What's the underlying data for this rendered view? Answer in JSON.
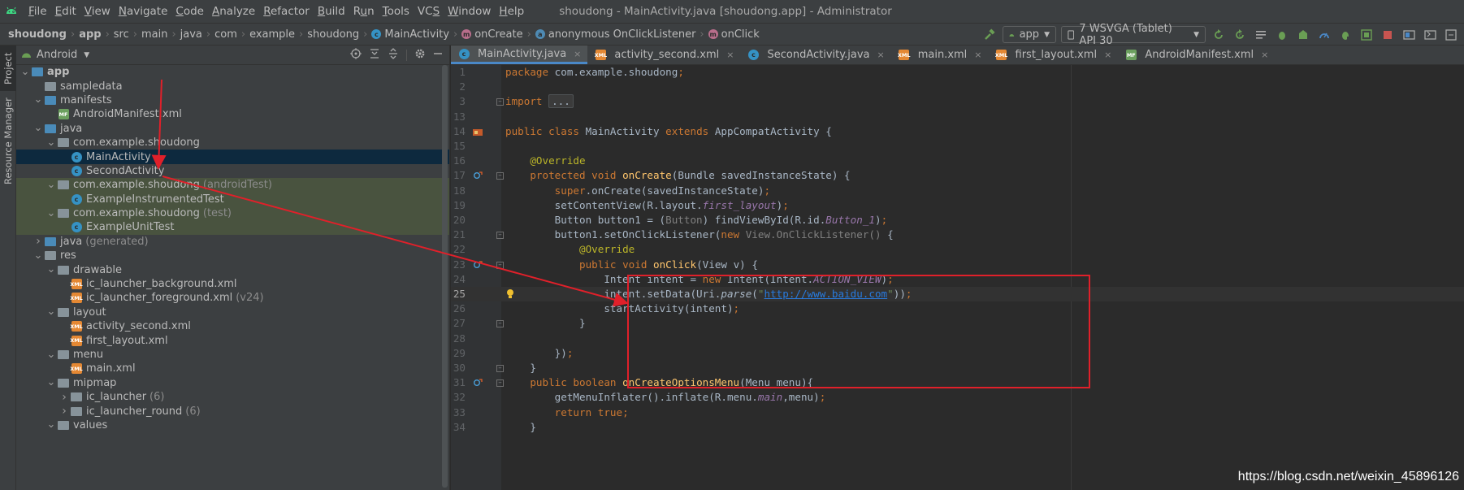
{
  "menubar": {
    "items": [
      {
        "label": "File",
        "mnemonic_index": 0
      },
      {
        "label": "Edit",
        "mnemonic_index": 0
      },
      {
        "label": "View",
        "mnemonic_index": 0
      },
      {
        "label": "Navigate",
        "mnemonic_index": 0
      },
      {
        "label": "Code",
        "mnemonic_index": 0
      },
      {
        "label": "Analyze",
        "mnemonic_index": 0
      },
      {
        "label": "Refactor",
        "mnemonic_index": 0
      },
      {
        "label": "Build",
        "mnemonic_index": 0
      },
      {
        "label": "Run",
        "mnemonic_index": 1
      },
      {
        "label": "Tools",
        "mnemonic_index": 0
      },
      {
        "label": "VCS",
        "mnemonic_index": 2
      },
      {
        "label": "Window",
        "mnemonic_index": 0
      },
      {
        "label": "Help",
        "mnemonic_index": 0
      }
    ],
    "window_title": "shoudong - MainActivity.java [shoudong.app] - Administrator"
  },
  "navbar": {
    "crumbs": [
      {
        "label": "shoudong",
        "bold": true
      },
      {
        "label": "app",
        "bold": true
      },
      {
        "label": "src"
      },
      {
        "label": "main"
      },
      {
        "label": "java"
      },
      {
        "label": "com"
      },
      {
        "label": "example"
      },
      {
        "label": "shoudong"
      },
      {
        "label": "MainActivity",
        "badge": "c"
      },
      {
        "label": "onCreate",
        "badge": "m"
      },
      {
        "label": "anonymous OnClickListener",
        "badge": "a"
      },
      {
        "label": "onClick",
        "badge": "m"
      }
    ],
    "run_config": "app",
    "device": "7  WSVGA (Tablet) API 30"
  },
  "stripe": {
    "project_tab": "Project",
    "resource_tab": "Resource Manager"
  },
  "project_panel": {
    "view_selector": "Android",
    "tree": [
      {
        "label": "app",
        "depth": 0,
        "expanded": true,
        "icon": "folder-blue",
        "bold": true
      },
      {
        "label": "sampledata",
        "depth": 1,
        "expanded": null,
        "icon": "folder"
      },
      {
        "label": "manifests",
        "depth": 1,
        "expanded": true,
        "icon": "folder-blue"
      },
      {
        "label": "AndroidManifest.xml",
        "depth": 2,
        "expanded": null,
        "icon": "manifest"
      },
      {
        "label": "java",
        "depth": 1,
        "expanded": true,
        "icon": "folder-blue"
      },
      {
        "label": "com.example.shoudong",
        "depth": 2,
        "expanded": true,
        "icon": "package"
      },
      {
        "label": "MainActivity",
        "depth": 3,
        "expanded": null,
        "icon": "class",
        "selected": true
      },
      {
        "label": "SecondActivity",
        "depth": 3,
        "expanded": null,
        "icon": "class"
      },
      {
        "label": "com.example.shoudong",
        "suffix": "(androidTest)",
        "depth": 2,
        "expanded": true,
        "icon": "package",
        "test": true
      },
      {
        "label": "ExampleInstrumentedTest",
        "depth": 3,
        "expanded": null,
        "icon": "class",
        "test": true
      },
      {
        "label": "com.example.shoudong",
        "suffix": "(test)",
        "depth": 2,
        "expanded": true,
        "icon": "package",
        "test": true
      },
      {
        "label": "ExampleUnitTest",
        "depth": 3,
        "expanded": null,
        "icon": "class",
        "test": true
      },
      {
        "label": "java",
        "suffix": "(generated)",
        "depth": 1,
        "expanded": false,
        "icon": "folder-blue"
      },
      {
        "label": "res",
        "depth": 1,
        "expanded": true,
        "icon": "folder"
      },
      {
        "label": "drawable",
        "depth": 2,
        "expanded": true,
        "icon": "folder"
      },
      {
        "label": "ic_launcher_background.xml",
        "depth": 3,
        "expanded": null,
        "icon": "xml"
      },
      {
        "label": "ic_launcher_foreground.xml",
        "suffix": "(v24)",
        "depth": 3,
        "expanded": null,
        "icon": "xml"
      },
      {
        "label": "layout",
        "depth": 2,
        "expanded": true,
        "icon": "folder"
      },
      {
        "label": "activity_second.xml",
        "depth": 3,
        "expanded": null,
        "icon": "xml"
      },
      {
        "label": "first_layout.xml",
        "depth": 3,
        "expanded": null,
        "icon": "xml"
      },
      {
        "label": "menu",
        "depth": 2,
        "expanded": true,
        "icon": "folder"
      },
      {
        "label": "main.xml",
        "depth": 3,
        "expanded": null,
        "icon": "xml"
      },
      {
        "label": "mipmap",
        "depth": 2,
        "expanded": true,
        "icon": "folder"
      },
      {
        "label": "ic_launcher",
        "suffix": "(6)",
        "depth": 3,
        "expanded": false,
        "icon": "folder"
      },
      {
        "label": "ic_launcher_round",
        "suffix": "(6)",
        "depth": 3,
        "expanded": false,
        "icon": "folder"
      },
      {
        "label": "values",
        "depth": 2,
        "expanded": true,
        "icon": "folder"
      }
    ]
  },
  "editor": {
    "tabs": [
      {
        "label": "MainActivity.java",
        "icon": "class",
        "active": true
      },
      {
        "label": "activity_second.xml",
        "icon": "xml"
      },
      {
        "label": "SecondActivity.java",
        "icon": "class"
      },
      {
        "label": "main.xml",
        "icon": "xml"
      },
      {
        "label": "first_layout.xml",
        "icon": "xml"
      },
      {
        "label": "AndroidManifest.xml",
        "icon": "manifest"
      }
    ],
    "lines": [
      {
        "n": "1",
        "tokens": [
          [
            "kw",
            "package "
          ],
          [
            "",
            "com.example.shoudong"
          ],
          [
            "kw",
            ";"
          ]
        ]
      },
      {
        "n": "2",
        "tokens": []
      },
      {
        "n": "3",
        "tokens": [
          [
            "kw",
            "import "
          ],
          [
            "dots",
            "..."
          ]
        ],
        "fold": true
      },
      {
        "n": "13",
        "tokens": []
      },
      {
        "n": "14",
        "tokens": [
          [
            "kw",
            "public class "
          ],
          [
            "",
            "MainActivity "
          ],
          [
            "kw",
            "extends "
          ],
          [
            "",
            "AppCompatActivity {"
          ]
        ],
        "mark": "android"
      },
      {
        "n": "15",
        "tokens": []
      },
      {
        "n": "16",
        "tokens": [
          [
            "",
            "    "
          ],
          [
            "ann",
            "@Override"
          ]
        ]
      },
      {
        "n": "17",
        "tokens": [
          [
            "",
            "    "
          ],
          [
            "kw",
            "protected void "
          ],
          [
            "fn",
            "onCreate"
          ],
          [
            "",
            "(Bundle savedInstanceState) {"
          ]
        ],
        "mark": "override",
        "fold": true
      },
      {
        "n": "18",
        "tokens": [
          [
            "",
            "        "
          ],
          [
            "kw",
            "super"
          ],
          [
            "",
            ".onCreate(savedInstanceState)"
          ],
          [
            "kw",
            ";"
          ]
        ]
      },
      {
        "n": "19",
        "tokens": [
          [
            "",
            "        setContentView(R.layout."
          ],
          [
            "italic",
            "first_layout"
          ],
          [
            "",
            ")"
          ],
          [
            "kw",
            ";"
          ]
        ]
      },
      {
        "n": "20",
        "tokens": [
          [
            "",
            "        Button button1 = ("
          ],
          [
            "dimtype",
            "Button"
          ],
          [
            "",
            ") findViewById(R.id."
          ],
          [
            "italic",
            "Button_1"
          ],
          [
            "",
            ")"
          ],
          [
            "kw",
            ";"
          ]
        ]
      },
      {
        "n": "21",
        "tokens": [
          [
            "",
            "        button1.setOnClickListener("
          ],
          [
            "kw",
            "new "
          ],
          [
            "dimtype",
            "View.OnClickListener() "
          ],
          [
            "",
            "{"
          ]
        ],
        "fold": true
      },
      {
        "n": "22",
        "tokens": [
          [
            "",
            "            "
          ],
          [
            "ann",
            "@Override"
          ]
        ]
      },
      {
        "n": "23",
        "tokens": [
          [
            "",
            "            "
          ],
          [
            "kw",
            "public void "
          ],
          [
            "fn",
            "onClick"
          ],
          [
            "",
            "(View v) {"
          ]
        ],
        "mark": "override",
        "fold": true
      },
      {
        "n": "24",
        "tokens": [
          [
            "",
            "                Intent intent = "
          ],
          [
            "kw",
            "new "
          ],
          [
            "",
            "Intent(Intent."
          ],
          [
            "italic",
            "ACTION_VIEW"
          ],
          [
            "",
            ")"
          ],
          [
            "kw",
            ";"
          ]
        ]
      },
      {
        "n": "25",
        "tokens": [
          [
            "",
            "                intent.setData(Uri."
          ],
          [
            "italicfn",
            "parse"
          ],
          [
            "",
            "("
          ],
          [
            "str",
            "\""
          ],
          [
            "link",
            "http://www.baidu.com"
          ],
          [
            "str",
            "\""
          ],
          [
            "",
            "))"
          ],
          [
            "kw",
            ";"
          ]
        ],
        "current": true,
        "mark": "bulb"
      },
      {
        "n": "26",
        "tokens": [
          [
            "",
            "                startActivity(intent)"
          ],
          [
            "kw",
            ";"
          ]
        ]
      },
      {
        "n": "27",
        "tokens": [
          [
            "",
            "            }"
          ]
        ],
        "fold": true
      },
      {
        "n": "28",
        "tokens": []
      },
      {
        "n": "29",
        "tokens": [
          [
            "",
            "        })"
          ],
          [
            "kw",
            ";"
          ]
        ]
      },
      {
        "n": "30",
        "tokens": [
          [
            "",
            "    }"
          ]
        ],
        "fold": true
      },
      {
        "n": "31",
        "tokens": [
          [
            "",
            "    "
          ],
          [
            "kw",
            "public boolean "
          ],
          [
            "fn",
            "onCreateOptionsMenu"
          ],
          [
            "",
            "(Menu menu){"
          ]
        ],
        "mark": "override",
        "fold": true
      },
      {
        "n": "32",
        "tokens": [
          [
            "",
            "        getMenuInflater().inflate(R.menu."
          ],
          [
            "italic",
            "main"
          ],
          [
            "",
            ",menu)"
          ],
          [
            "kw",
            ";"
          ]
        ]
      },
      {
        "n": "33",
        "tokens": [
          [
            "",
            "        "
          ],
          [
            "kw",
            "return true;"
          ]
        ]
      },
      {
        "n": "34",
        "tokens": [
          [
            "",
            "    }"
          ]
        ]
      }
    ]
  },
  "annotation": {
    "color": "#e0202a"
  },
  "watermark": "https://blog.csdn.net/weixin_45896126"
}
